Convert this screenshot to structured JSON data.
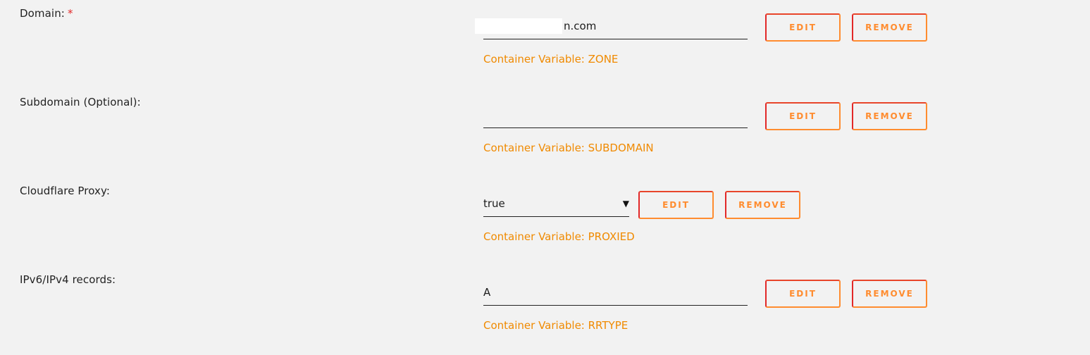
{
  "rows": [
    {
      "label": "Domain:",
      "required_mark": "*",
      "value": "n.com",
      "hint": "Container Variable: ZONE",
      "edit_label": "EDIT",
      "remove_label": "REMOVE"
    },
    {
      "label": "Subdomain (Optional):",
      "value": "",
      "hint": "Container Variable: SUBDOMAIN",
      "edit_label": "EDIT",
      "remove_label": "REMOVE"
    },
    {
      "label": "Cloudflare Proxy:",
      "value": "true",
      "hint": "Container Variable: PROXIED",
      "edit_label": "EDIT",
      "remove_label": "REMOVE"
    },
    {
      "label": "IPv6/IPv4 records:",
      "value": "A",
      "hint": "Container Variable: RRTYPE",
      "edit_label": "EDIT",
      "remove_label": "REMOVE"
    }
  ],
  "colors": {
    "background": "#f2f2f2",
    "hint": "#f08a00",
    "button_gradient_start": "#e22828",
    "button_gradient_end": "#ff8c2f",
    "required": "#e22828"
  },
  "icons": {
    "select_caret": "▼"
  }
}
